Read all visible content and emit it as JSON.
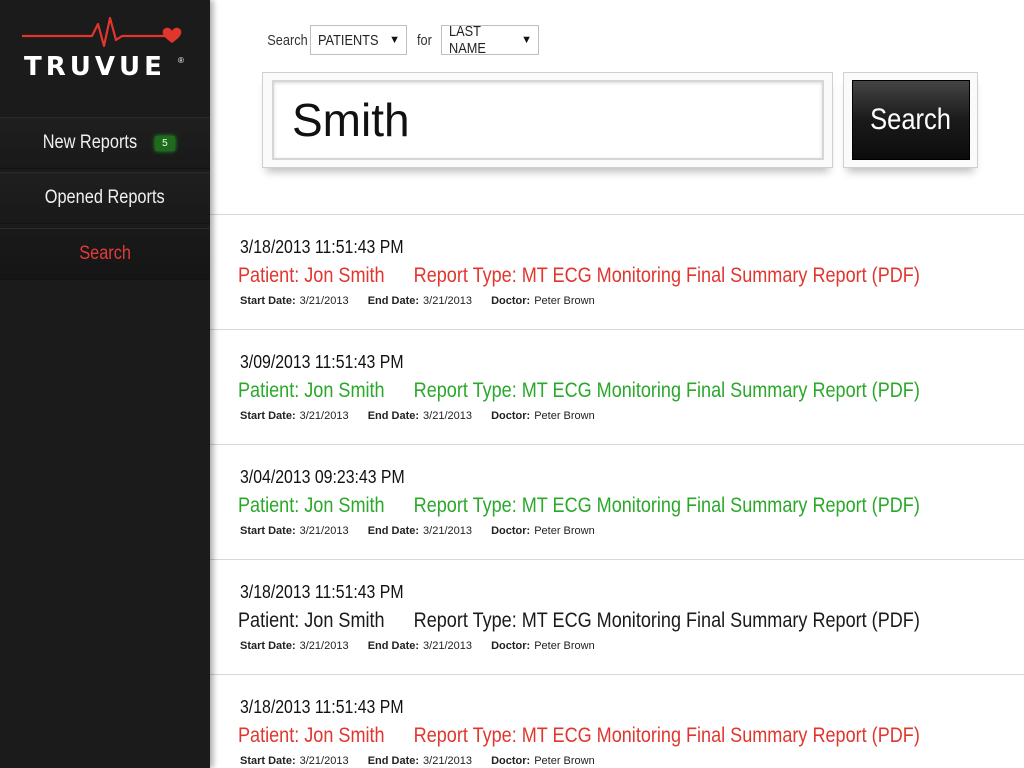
{
  "brand": {
    "name": "TRUVUE",
    "reg": "®"
  },
  "nav": {
    "items": [
      {
        "label": "New Reports",
        "badge": "5"
      },
      {
        "label": "Opened Reports"
      },
      {
        "label": "Search"
      }
    ]
  },
  "search": {
    "search_label": "Search",
    "category": "PATIENTS",
    "for_label": "for",
    "field": "LAST NAME",
    "query": "Smith",
    "button_label": "Search"
  },
  "labels": {
    "start_date": "Start Date:",
    "end_date": "End Date:",
    "doctor": "Doctor:"
  },
  "colors": {
    "red": "#e0362e",
    "green": "#2aa82a",
    "black": "#1a1a1a"
  },
  "results": [
    {
      "timestamp": "3/18/2013 11:51:43 PM",
      "patient": "Patient: Jon Smith",
      "report_type": "Report Type: MT ECG Monitoring Final Summary Report (PDF)",
      "start": "3/21/2013",
      "end": "3/21/2013",
      "doctor": "Peter Brown",
      "status": "red"
    },
    {
      "timestamp": "3/09/2013 11:51:43 PM",
      "patient": "Patient: Jon Smith",
      "report_type": "Report Type: MT ECG Monitoring Final Summary Report (PDF)",
      "start": "3/21/2013",
      "end": "3/21/2013",
      "doctor": "Peter Brown",
      "status": "green"
    },
    {
      "timestamp": "3/04/2013 09:23:43 PM",
      "patient": "Patient: Jon Smith",
      "report_type": "Report Type: MT ECG Monitoring Final Summary Report (PDF)",
      "start": "3/21/2013",
      "end": "3/21/2013",
      "doctor": "Peter Brown",
      "status": "green"
    },
    {
      "timestamp": "3/18/2013 11:51:43 PM",
      "patient": "Patient: Jon Smith",
      "report_type": "Report Type: MT ECG Monitoring Final Summary Report (PDF)",
      "start": "3/21/2013",
      "end": "3/21/2013",
      "doctor": "Peter Brown",
      "status": "black"
    },
    {
      "timestamp": "3/18/2013 11:51:43 PM",
      "patient": "Patient: Jon Smith",
      "report_type": "Report Type: MT ECG Monitoring Final Summary Report (PDF)",
      "start": "3/21/2013",
      "end": "3/21/2013",
      "doctor": "Peter Brown",
      "status": "red"
    }
  ]
}
